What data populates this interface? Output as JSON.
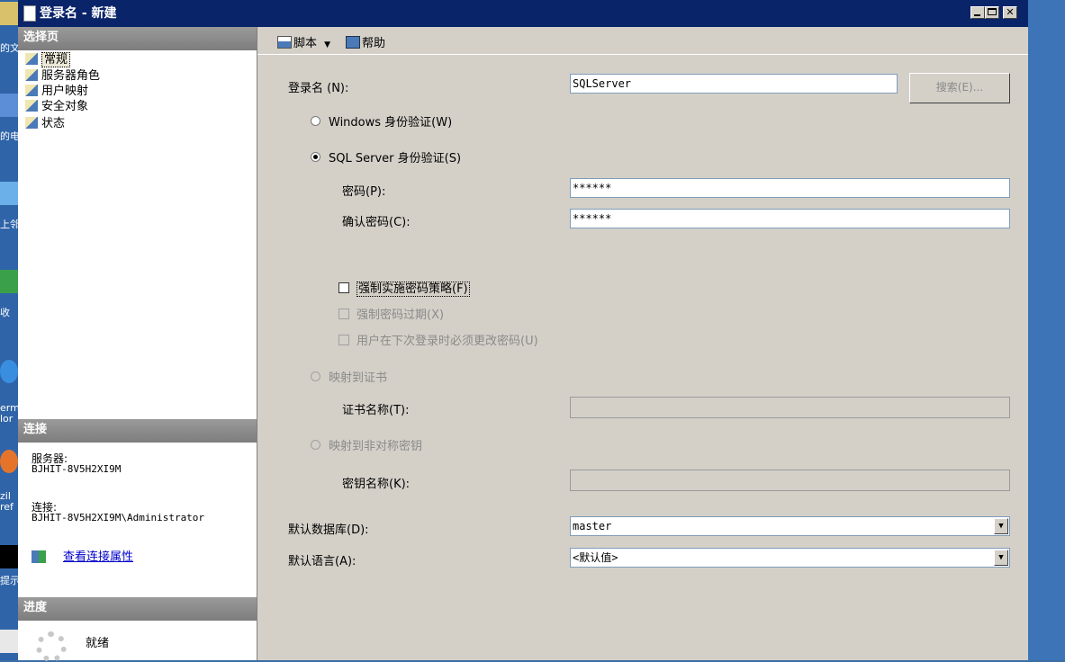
{
  "window": {
    "title": "登录名 - 新建"
  },
  "desktop": {
    "labels": [
      "的文",
      "的电",
      "上邻",
      "收",
      "erm\nlor",
      "zil\nref",
      "提示"
    ]
  },
  "left": {
    "select_page_header": "选择页",
    "pages": [
      {
        "label": "常规",
        "selected": true
      },
      {
        "label": "服务器角色"
      },
      {
        "label": "用户映射"
      },
      {
        "label": "安全对象"
      },
      {
        "label": "状态"
      }
    ],
    "connection_header": "连接",
    "server_label": "服务器:",
    "server_value": "BJHIT-8V5H2XI9M",
    "connection_label": "连接:",
    "connection_value": "BJHIT-8V5H2XI9M\\Administrator",
    "view_props_link": "查看连接属性",
    "progress_header": "进度",
    "progress_status": "就绪"
  },
  "toolbar": {
    "script_label": "脚本",
    "help_label": "帮助"
  },
  "form": {
    "login_name_label": "登录名 (N):",
    "login_name_value": "SQLServer",
    "search_button": "搜索(E)...",
    "windows_auth_label": "Windows 身份验证(W)",
    "sql_auth_label": "SQL Server 身份验证(S)",
    "password_label": "密码(P):",
    "password_value": "******",
    "confirm_password_label": "确认密码(C):",
    "confirm_password_value": "******",
    "enforce_policy_label": "强制实施密码策略(F)",
    "enforce_expiration_label": "强制密码过期(X)",
    "must_change_label": "用户在下次登录时必须更改密码(U)",
    "map_cert_label": "映射到证书",
    "cert_name_label": "证书名称(T):",
    "map_asym_key_label": "映射到非对称密钥",
    "key_name_label": "密钥名称(K):",
    "default_db_label": "默认数据库(D):",
    "default_db_value": "master",
    "default_lang_label": "默认语言(A):",
    "default_lang_value": "<默认值>"
  }
}
